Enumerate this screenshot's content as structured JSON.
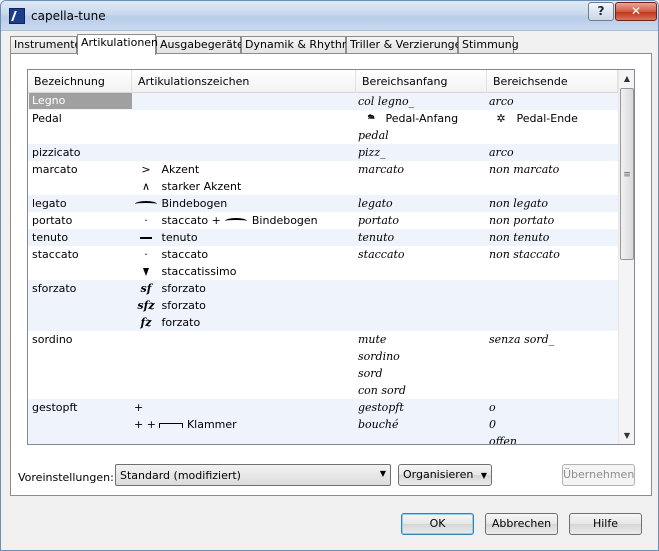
{
  "window": {
    "title": "capella-tune"
  },
  "titlebar": {
    "help_label": "?",
    "close_label": "✕"
  },
  "tabs": [
    {
      "label": "Instrumente"
    },
    {
      "label": "Artikulationen"
    },
    {
      "label": "Ausgabegeräte"
    },
    {
      "label": "Dynamik & Rhythmik"
    },
    {
      "label": "Triller & Verzierungen"
    },
    {
      "label": "Stimmung"
    }
  ],
  "columns": [
    "Bezeichnung",
    "Artikulationszeichen",
    "Bereichsanfang",
    "Bereichsende"
  ],
  "rows": {
    "legno": {
      "name": "Legno",
      "start": "col legno_",
      "end": "arco"
    },
    "pedal": {
      "name": "Pedal",
      "start1": "Pedal-Anfang",
      "end1": "Pedal-Ende",
      "start2": "pedal"
    },
    "pizzicato": {
      "name": "pizzicato",
      "start": "pizz_",
      "end": "arco"
    },
    "marcato": {
      "name": "marcato",
      "sym1": "Akzent",
      "sym2": "starker Akzent",
      "start": "marcato",
      "end": "non marcato"
    },
    "legato": {
      "name": "legato",
      "sym1": "Bindebogen",
      "start": "legato",
      "end": "non legato"
    },
    "portato": {
      "name": "portato",
      "sym1": "staccato",
      "sym_plus": "+",
      "sym2": "Bindebogen",
      "start": "portato",
      "end": "non portato"
    },
    "tenuto": {
      "name": "tenuto",
      "sym1": "tenuto",
      "start": "tenuto",
      "end": "non tenuto"
    },
    "staccato": {
      "name": "staccato",
      "sym1": "staccato",
      "sym2": "staccatissimo",
      "start": "staccato",
      "end": "non staccato"
    },
    "sforzato": {
      "name": "sforzato",
      "g1": "sf",
      "sym1": "sforzato",
      "g2": "sfz",
      "sym2": "sforzato",
      "g3": "fz",
      "sym3": "forzato"
    },
    "sordino": {
      "name": "sordino",
      "start1": "mute",
      "start2": "sordino",
      "start3": "sord",
      "start4": "con sord",
      "end1": "senza sord_"
    },
    "gestopft": {
      "name": "gestopft",
      "sym_g1": "+",
      "sym_g2": "+ +",
      "sym2": "Klammer",
      "start1": "gestopft",
      "start2": "bouché",
      "end1": "o",
      "end2": "0",
      "end3": "offen"
    }
  },
  "footer": {
    "preset_label": "Voreinstellungen:",
    "preset_value": "Standard (modifiziert)",
    "organize_label": "Organisieren",
    "apply_label": "Übernehmen"
  },
  "buttons": {
    "ok": "OK",
    "cancel": "Abbrechen",
    "help": "Hilfe"
  }
}
